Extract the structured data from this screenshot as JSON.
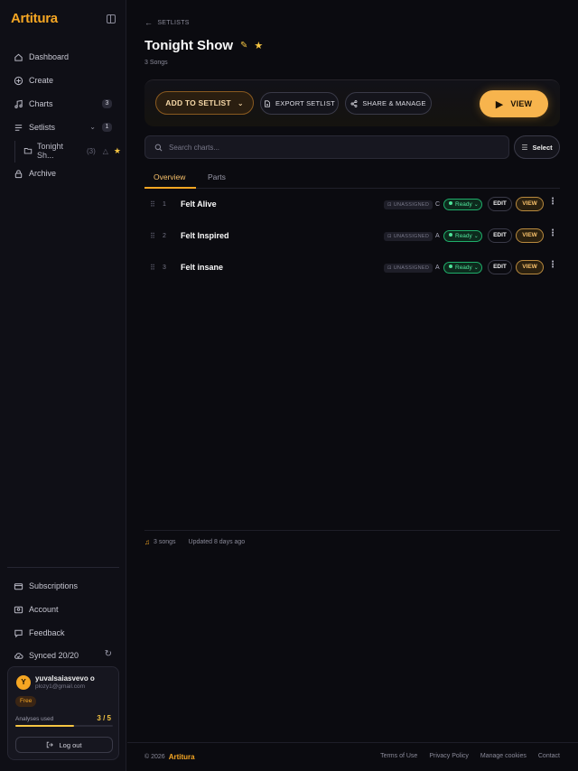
{
  "brand": {
    "name": "Artitura",
    "accent": "#f5a623"
  },
  "sidebar": {
    "items": [
      {
        "label": "Dashboard",
        "icon": "home-icon"
      },
      {
        "label": "Create",
        "icon": "plus-circle-icon"
      },
      {
        "label": "Charts",
        "icon": "music-note-icon",
        "badge": "3"
      },
      {
        "label": "Setlists",
        "icon": "list-icon",
        "badge": "1"
      },
      {
        "label": "Archive",
        "icon": "lock-icon"
      }
    ],
    "sub_item": {
      "label": "Tonight Sh...",
      "count": "(3)",
      "icon": "folder-icon"
    },
    "bottom": [
      {
        "label": "Subscriptions",
        "icon": "card-icon"
      },
      {
        "label": "Account",
        "icon": "user-icon"
      },
      {
        "label": "Feedback",
        "icon": "message-icon"
      }
    ],
    "sync": {
      "label": "Synced 20/20",
      "icon": "cloud-check-icon"
    },
    "user": {
      "initial": "Y",
      "name": "yuvalsaiasvevo o",
      "email": "plozy1@gmail.com",
      "plan": "Free",
      "analyses_label": "Analyses used",
      "analyses_value": "3 / 5",
      "analyses_used": 3,
      "analyses_total": 5,
      "logout": "Log out"
    }
  },
  "page": {
    "breadcrumb": "SETLISTS",
    "title": "Tonight Show",
    "subtitle": "3 Songs",
    "actions": {
      "add": "ADD TO SETLIST",
      "export": "EXPORT SETLIST",
      "share": "SHARE & MANAGE",
      "view": "VIEW"
    },
    "search_placeholder": "Search charts...",
    "select": "Select",
    "tabs": [
      "Overview",
      "Parts"
    ],
    "songs": [
      {
        "num": "1",
        "name": "Felt Alive",
        "assigned": "UNASSIGNED",
        "key": "C",
        "status": "Ready",
        "edit": "EDIT",
        "view": "VIEW"
      },
      {
        "num": "2",
        "name": "Felt Inspired",
        "assigned": "UNASSIGNED",
        "key": "A",
        "status": "Ready",
        "edit": "EDIT",
        "view": "VIEW"
      },
      {
        "num": "3",
        "name": "Felt insane",
        "assigned": "UNASSIGNED",
        "key": "A",
        "status": "Ready",
        "edit": "EDIT",
        "view": "VIEW"
      }
    ],
    "meta": {
      "songs": "3 songs",
      "updated": "Updated 8 days ago"
    }
  },
  "footer": {
    "copyright": "© 2026",
    "links": [
      "Terms of Use",
      "Privacy Policy",
      "Manage cookies",
      "Contact"
    ]
  }
}
